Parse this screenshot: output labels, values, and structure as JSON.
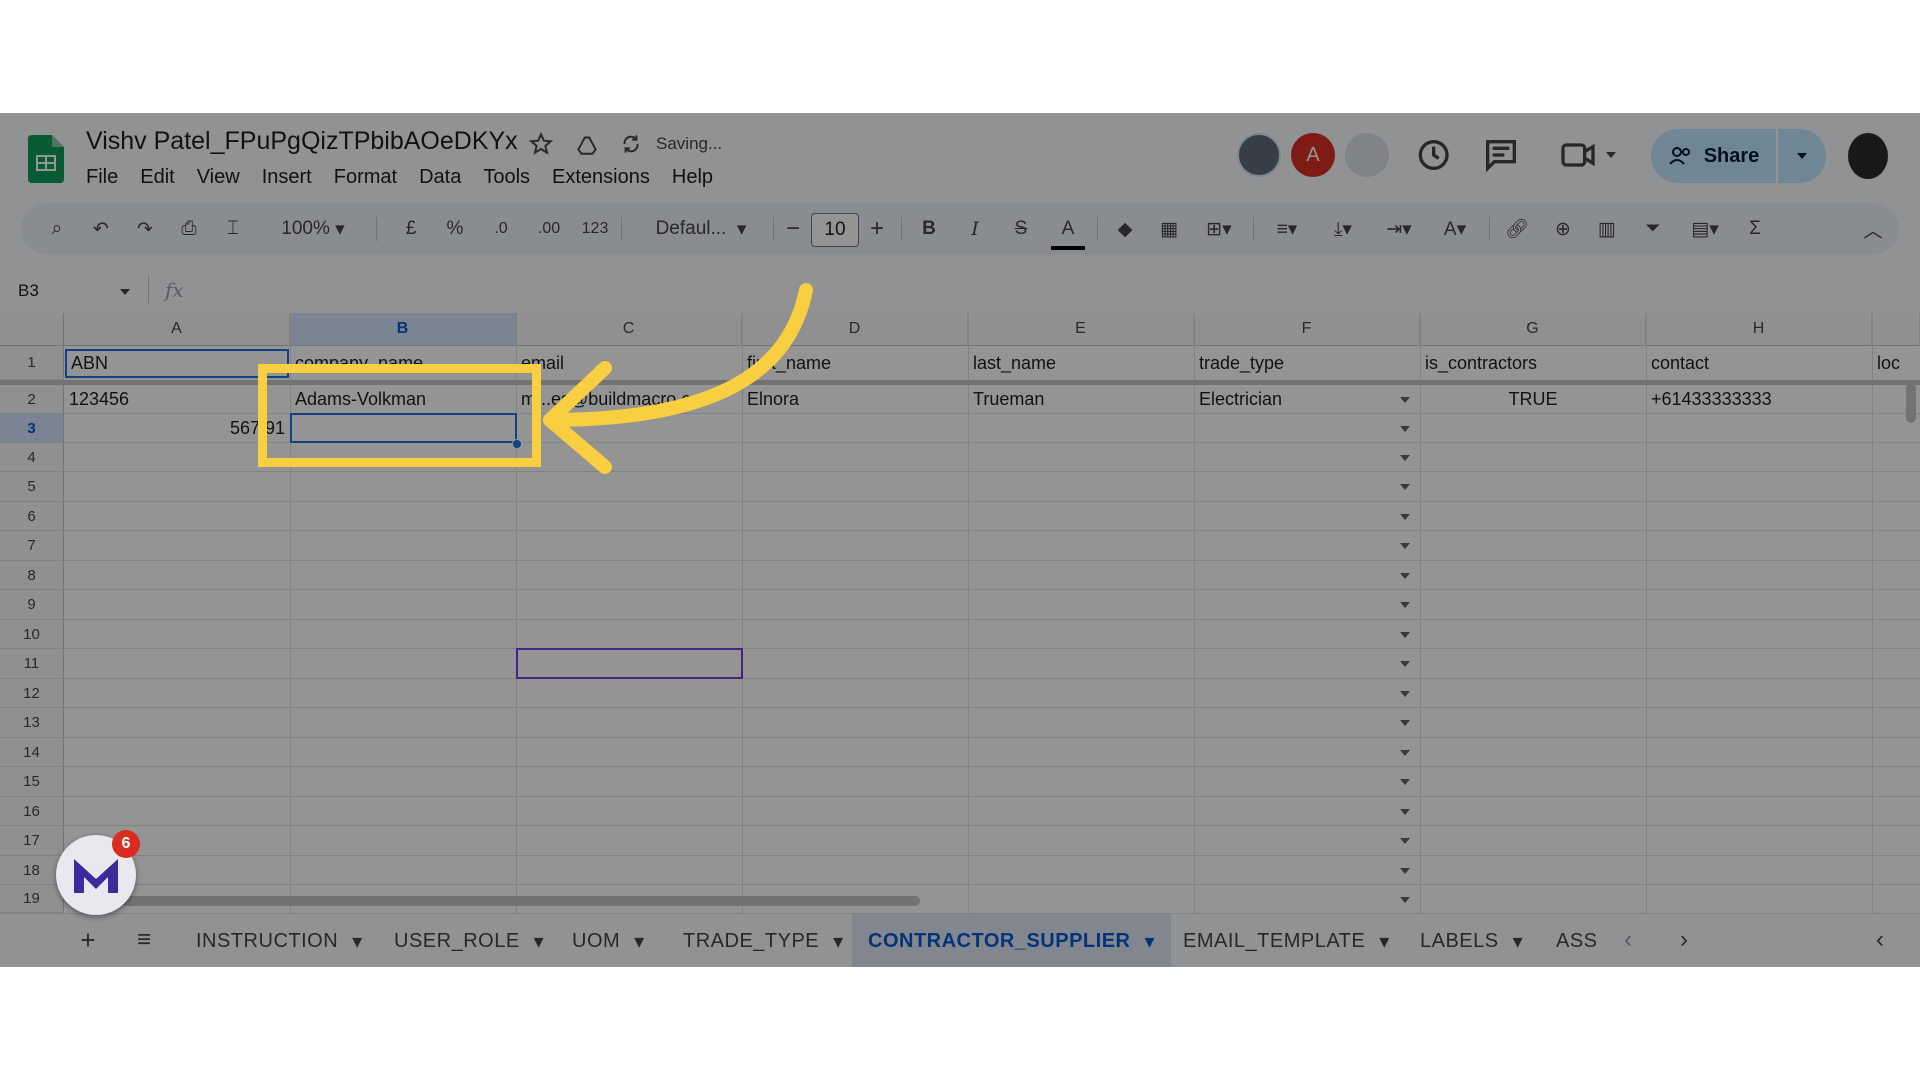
{
  "header": {
    "doc_title": "Vishv Patel_FPuPgQizTPbibAOeDKYx",
    "save_status": "Saving...",
    "menu": [
      "File",
      "Edit",
      "View",
      "Insert",
      "Format",
      "Data",
      "Tools",
      "Extensions",
      "Help"
    ],
    "avatar_letter": "A",
    "share_label": "Share"
  },
  "toolbar": {
    "zoom": "100%",
    "currency": "£",
    "percent": "%",
    "dec_decrease": ".0",
    "dec_increase": ".00",
    "number_format": "123",
    "font": "Defaul...",
    "font_size": "10",
    "bold": "B",
    "italic": "I",
    "strike": "S",
    "text_color": "A"
  },
  "formula_bar": {
    "name_box": "B3",
    "fx": "fx"
  },
  "grid": {
    "columns": [
      "A",
      "B",
      "C",
      "D",
      "E",
      "F",
      "G",
      "H"
    ],
    "selected_column": "B",
    "rows": [
      "1",
      "2",
      "3",
      "4",
      "5",
      "6",
      "7",
      "8",
      "9",
      "10",
      "11",
      "12",
      "13",
      "14",
      "15",
      "16",
      "17",
      "18",
      "19"
    ],
    "selected_row": "3",
    "header_row": [
      "ABN",
      "company_name",
      "email",
      "first_name",
      "last_name",
      "trade_type",
      "is_contractors",
      "contact",
      "loc"
    ],
    "row2": [
      "123456",
      "Adams-Volkman",
      "m...es@buildmacro.c...",
      "Elnora",
      "Trueman",
      "Electrician",
      "TRUE",
      "+61433333333"
    ],
    "row3": [
      "567 91"
    ]
  },
  "sheets": {
    "tabs": [
      "INSTRUCTION",
      "USER_ROLE",
      "UOM",
      "TRADE_TYPE",
      "CONTRACTOR_SUPPLIER",
      "EMAIL_TEMPLATE",
      "LABELS",
      "ASS"
    ],
    "active": "CONTRACTOR_SUPPLIER"
  },
  "badge": {
    "count": "6"
  },
  "colors": {
    "highlight": "#f8cf40",
    "sheets_green": "#0f9d58",
    "selection_blue": "#0b57d0"
  }
}
